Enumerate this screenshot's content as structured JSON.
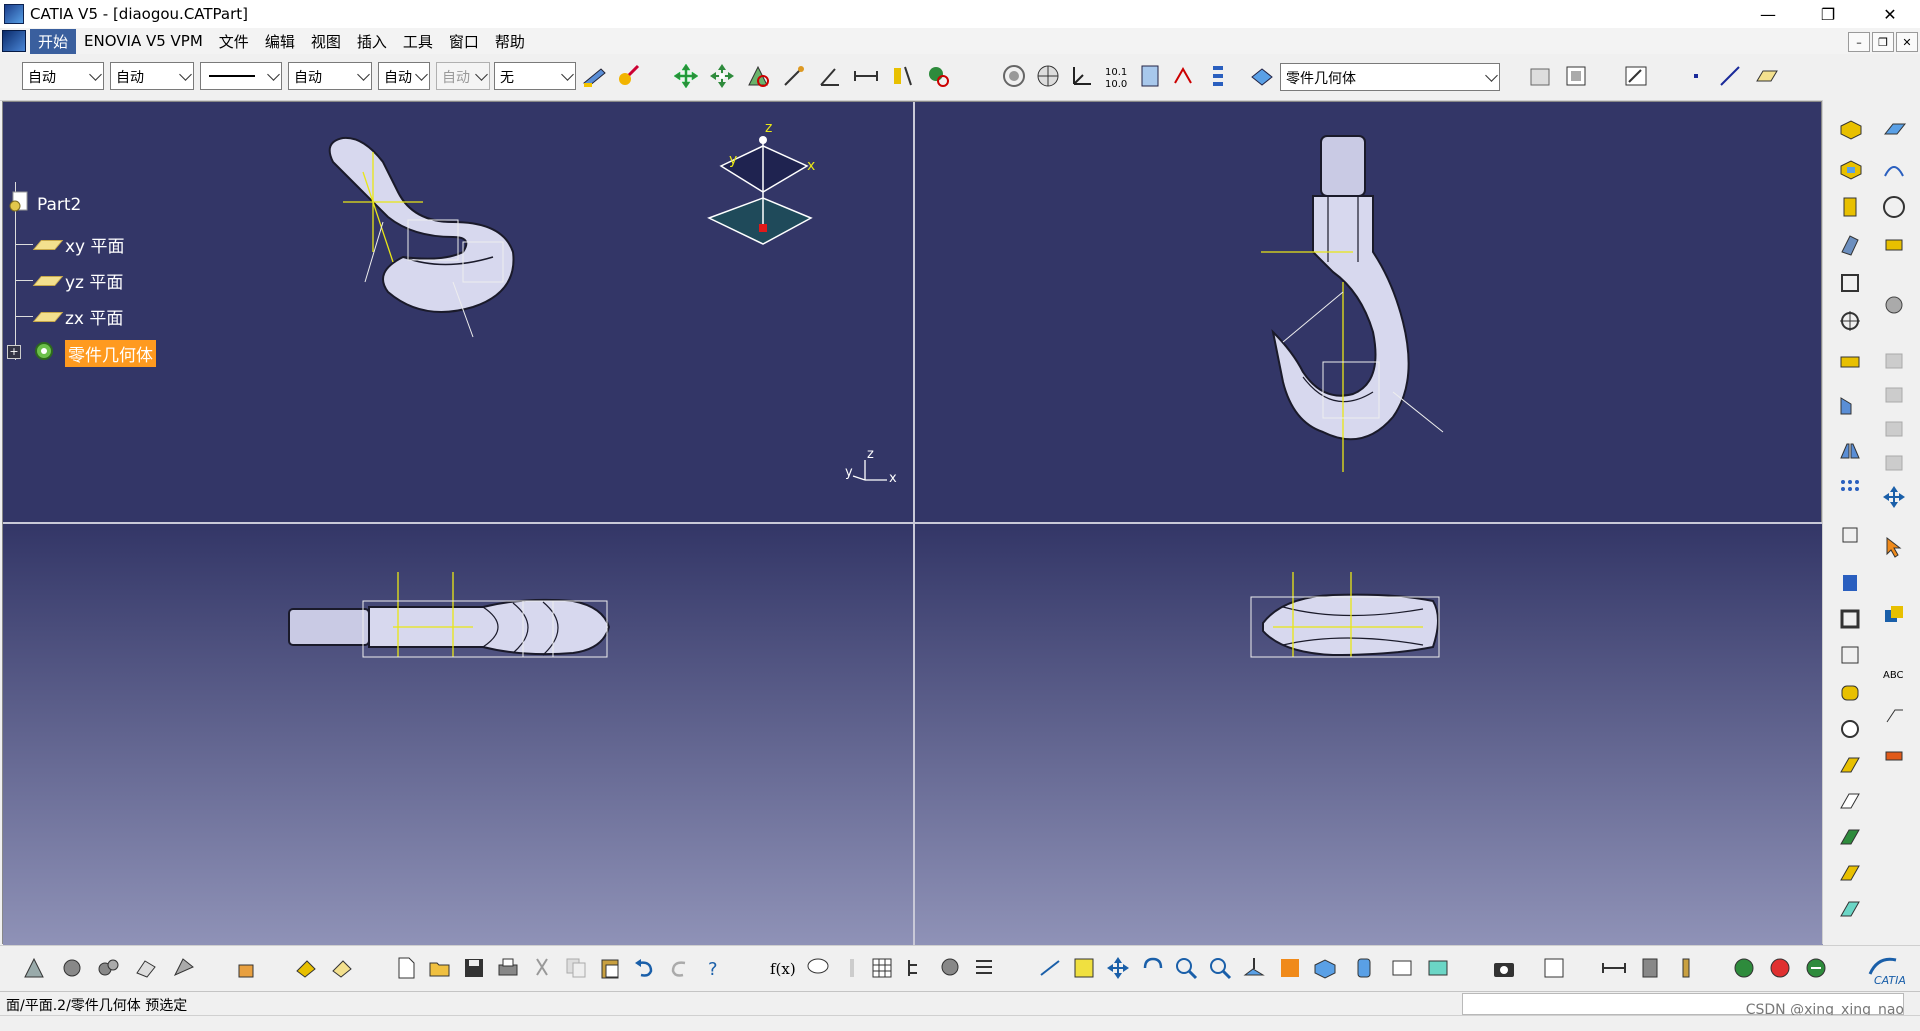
{
  "window": {
    "title": "CATIA V5 - [diaogou.CATPart]",
    "minimize": "—",
    "restore": "❐",
    "close": "✕"
  },
  "menu": {
    "items": [
      "开始",
      "ENOVIA V5 VPM",
      "文件",
      "编辑",
      "视图",
      "插入",
      "工具",
      "窗口",
      "帮助"
    ],
    "mdi_minimize": "–",
    "mdi_restore": "❐",
    "mdi_close": "✕"
  },
  "toolbar": {
    "combos": [
      "自动",
      "自动",
      "",
      "自动",
      "自动",
      "自动",
      "无"
    ],
    "body_selector": "零件几何体"
  },
  "tree": {
    "root": "Part2",
    "items": [
      "xy 平面",
      "yz 平面",
      "zx 平面",
      "零件几何体"
    ],
    "expander": "+"
  },
  "compass": {
    "x": "x",
    "y": "y",
    "z": "z"
  },
  "axis_triad": {
    "x": "x",
    "y": "y",
    "z": "z"
  },
  "status": {
    "text": "面/平面.2/零件几何体 预选定"
  },
  "watermark": "CSDN @xing_xing_nao",
  "colors": {
    "viewport_bg": "#333667",
    "highlight": "#ff9a1f",
    "geometry": "#d7d8ee",
    "sketch": "#e9e616"
  }
}
